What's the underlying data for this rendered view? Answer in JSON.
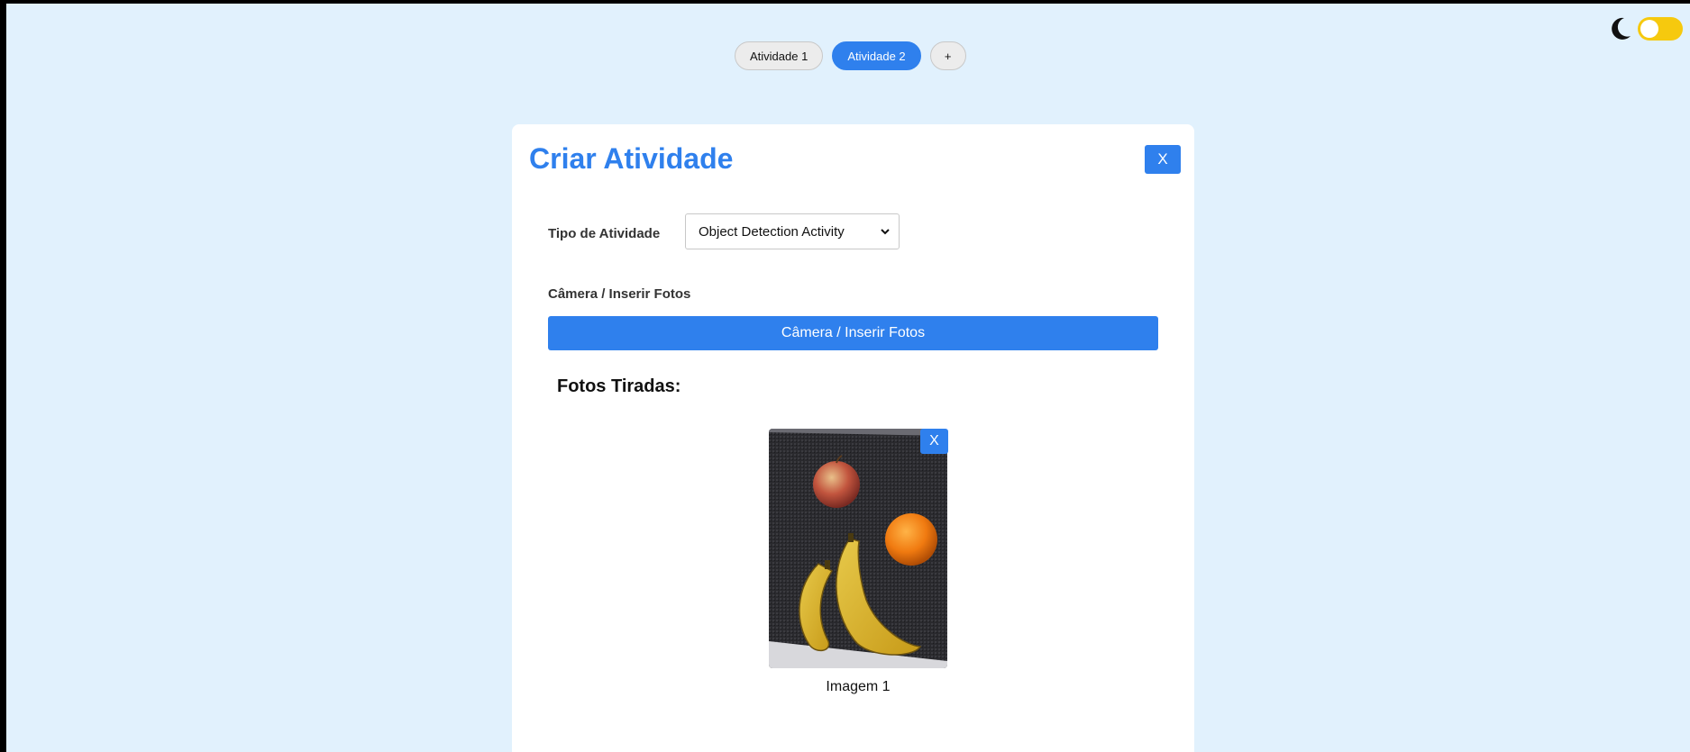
{
  "tabs": [
    {
      "label": "Atividade 1",
      "active": false
    },
    {
      "label": "Atividade 2",
      "active": true
    },
    {
      "label": "+",
      "active": false
    }
  ],
  "theme_toggle": {
    "icon": "moon-icon",
    "state": "off",
    "accent": "#f6c90e"
  },
  "modal": {
    "title": "Criar Atividade",
    "close_label": "X",
    "activity_type_label": "Tipo de Atividade",
    "activity_type_value": "Object Detection Activity",
    "camera_label": "Câmera / Inserir Fotos",
    "camera_button_label": "Câmera / Inserir Fotos",
    "photos_heading": "Fotos Tiradas:",
    "photos": [
      {
        "caption": "Imagem 1",
        "remove_label": "X"
      }
    ]
  },
  "colors": {
    "accent": "#2f80ed",
    "background": "#e1f1fd"
  }
}
